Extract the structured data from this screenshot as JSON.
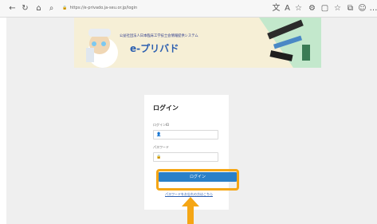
{
  "browser": {
    "url": "https://e-privado.ja-seu.or.jp/login",
    "icons": [
      "back-icon",
      "forward-icon",
      "home-icon",
      "search-icon",
      "security-icon",
      "extensions-icon",
      "favorites-icon",
      "profile-icon",
      "menu-icon"
    ]
  },
  "banner": {
    "org": "公益社団法人日本臨床工学技士会情報提供システム",
    "brand": "e-プリバド"
  },
  "login": {
    "title": "ログイン",
    "id_label": "ログインID",
    "id_value": "",
    "password_label": "パスワード",
    "password_value": "",
    "submit_label": "ログイン",
    "forgot_link": "パスワードをお忘れの方はこちら"
  },
  "colors": {
    "highlight": "#f5a615",
    "button": "#2a80c8",
    "brand": "#2c5fb0"
  }
}
